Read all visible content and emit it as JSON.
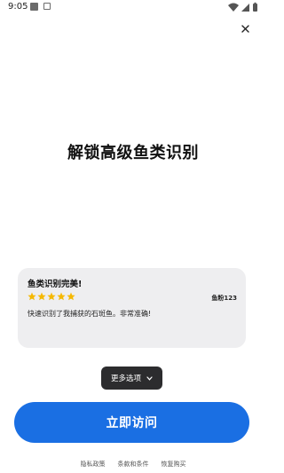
{
  "status_bar": {
    "time": "9:05"
  },
  "headline": "解锁高级鱼类识别",
  "review": {
    "title": "鱼类识别完美!",
    "rating": 5,
    "star_color": "#f5b800",
    "author": "鱼粉123",
    "text": "快速识别了我捕获的石斑鱼。非常准确!"
  },
  "more_options_label": "更多选项",
  "cta_label": "立即访问",
  "accent_color": "#1a6fe3",
  "footer": {
    "privacy": "隐私政策",
    "terms": "条款和条件",
    "restore": "恢复购买"
  }
}
